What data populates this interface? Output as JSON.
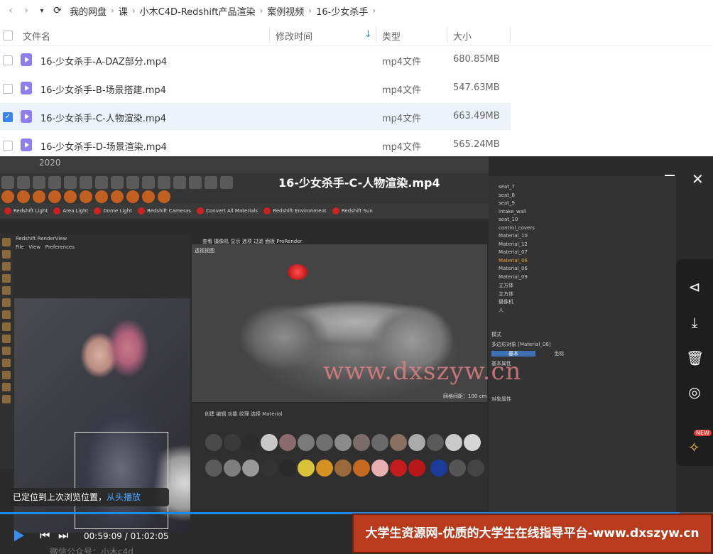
{
  "nav": {
    "back_icon": "chevron-left-icon",
    "forward_icon": "chevron-right-icon",
    "dropdown_icon": "caret-down-icon",
    "refresh_icon": "refresh-icon",
    "crumbs": [
      "我的网盘",
      "课",
      "小木C4D-Redshift产品渲染",
      "案例视频",
      "16-少女杀手"
    ]
  },
  "columns": {
    "name": "文件名",
    "modified": "修改时间",
    "sort_icon": "arrow-down-icon",
    "type": "类型",
    "size": "大小"
  },
  "files": [
    {
      "name": "16-少女杀手-A-DAZ部分.mp4",
      "type": "mp4文件",
      "size": "680.85MB",
      "selected": false
    },
    {
      "name": "16-少女杀手-B-场景搭建.mp4",
      "type": "mp4文件",
      "size": "547.63MB",
      "selected": false
    },
    {
      "name": "16-少女杀手-C-人物渲染.mp4",
      "type": "mp4文件",
      "size": "663.49MB",
      "selected": true
    },
    {
      "name": "16-少女杀手-D-场景渲染.mp4",
      "type": "mp4文件",
      "size": "565.24MB",
      "selected": false
    }
  ],
  "player": {
    "title": "16-少女杀手-C-人物渲染.mp4",
    "window_controls": [
      "minimize-icon",
      "maximize-icon",
      "close-icon"
    ],
    "c4d_version": "2020",
    "shelf_items": [
      "Redshift Light",
      "Area Light",
      "Dome Light",
      "Redshift Cameras",
      "Convert All Materials",
      "Redshift Environment",
      "Redshift Sun"
    ],
    "renderview": {
      "title": "Redshift RenderView",
      "menu": [
        "File",
        "View",
        "Preferences"
      ]
    },
    "viewport": {
      "menu": [
        "查看",
        "摄像机",
        "显示",
        "选项",
        "过滤",
        "面板",
        "ProRender"
      ],
      "label": "透视视图",
      "footer": "网格间距：100 cm"
    },
    "materials_menu": [
      "创建",
      "编辑",
      "功能",
      "纹理",
      "选择",
      "Material"
    ],
    "object_list": [
      "seat_7",
      "seat_8",
      "seat_9",
      "intake_wall",
      "seat_10",
      "control_covers",
      "Material_10",
      "Material_12",
      "Material_07",
      "Material_08",
      "Material_06",
      "Material_09",
      "立方体",
      "立方体",
      "摄像机",
      "人"
    ],
    "attr": {
      "mode": "模式",
      "title": "多边形对象 [Material_08]",
      "basic": "基本",
      "coord": "坐标",
      "fields": [
        "基本属性",
        "对象属性"
      ]
    },
    "watermark": "www.dxszyw.cn",
    "side_buttons": [
      "share-icon",
      "download-icon",
      "delete-icon",
      "target-icon"
    ],
    "pin_icon": "pin-icon",
    "pin_badge": "NEW",
    "toast": {
      "text": "已定位到上次浏览位置，",
      "link": "从头播放"
    },
    "time": "00:59:09 / 01:02:05",
    "progress": 0.953,
    "ad": "大学生资源网-优质的大学生在线指导平台-www.dxszyw.cn",
    "footer_text": "微信公众号：小木c4d"
  }
}
